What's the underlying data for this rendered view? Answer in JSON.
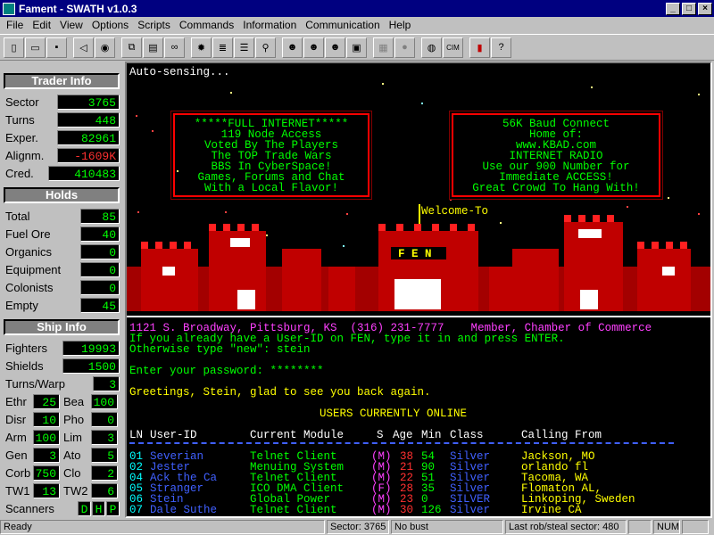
{
  "window": {
    "title": "Fament - SWATH v1.0.3"
  },
  "menu": [
    "File",
    "Edit",
    "View",
    "Options",
    "Scripts",
    "Commands",
    "Information",
    "Communication",
    "Help"
  ],
  "toolbar_icons": [
    "new-icon",
    "open-icon",
    "save-icon",
    "disconnect-icon",
    "connect-icon",
    "copy-icon",
    "paste-icon",
    "find-icon",
    "idea-icon",
    "notes-icon",
    "list-icon",
    "search-icon",
    "people-icon",
    "people2-icon",
    "people3-icon",
    "lock-icon",
    "gray1-icon",
    "gray2-icon",
    "globe-icon",
    "cim-icon",
    "book-icon",
    "help-icon"
  ],
  "trader_info": {
    "header": "Trader Info",
    "rows": [
      {
        "label": "Sector",
        "value": "3765"
      },
      {
        "label": "Turns",
        "value": "448"
      },
      {
        "label": "Exper.",
        "value": "82961"
      },
      {
        "label": "Alignm.",
        "value": "-1609K"
      },
      {
        "label": "Cred.",
        "value": "410483"
      }
    ]
  },
  "holds": {
    "header": "Holds",
    "rows": [
      {
        "label": "Total",
        "value": "85"
      },
      {
        "label": "Fuel Ore",
        "value": "40"
      },
      {
        "label": "Organics",
        "value": "0"
      },
      {
        "label": "Equipment",
        "value": "0"
      },
      {
        "label": "Colonists",
        "value": "0"
      },
      {
        "label": "Empty",
        "value": "45"
      }
    ]
  },
  "ship_info": {
    "header": "Ship Info",
    "rows": [
      {
        "label": "Fighters",
        "value": "19993"
      },
      {
        "label": "Shields",
        "value": "1500"
      },
      {
        "label": "Turns/Warp",
        "value": "3"
      }
    ],
    "pairs": [
      [
        {
          "label": "Ethr",
          "value": "25"
        },
        {
          "label": "Bea",
          "value": "100"
        }
      ],
      [
        {
          "label": "Disr",
          "value": "10"
        },
        {
          "label": "Pho",
          "value": "0"
        }
      ],
      [
        {
          "label": "Arm",
          "value": "100"
        },
        {
          "label": "Lim",
          "value": "3"
        }
      ],
      [
        {
          "label": "Gen",
          "value": "3"
        },
        {
          "label": "Ato",
          "value": "5"
        }
      ],
      [
        {
          "label": "Corb",
          "value": "750"
        },
        {
          "label": "Clo",
          "value": "2"
        }
      ],
      [
        {
          "label": "TW1",
          "value": "13"
        },
        {
          "label": "TW2",
          "value": "6"
        }
      ]
    ],
    "scanners_label": "Scanners",
    "scanners": [
      "D",
      "H",
      "P"
    ]
  },
  "terminal": {
    "auto_sensing": "Auto-sensing...",
    "box_left": "*****FULL INTERNET*****\n119 Node Access\nVoted By The Players\nThe TOP Trade Wars\nBBS In CyberSpace!\nGames, Forums and Chat\nWith a Local Flavor!",
    "box_right": "56K Baud Connect\nHome of:\nwww.KBAD.com\nINTERNET RADIO\nUse our 900 Number for\nImmediate ACCESS!\nGreat Crowd To Hang With!",
    "welcome": "Welcome-To",
    "castle_sign": "F E N",
    "address": "1121 S. Broadway, Pittsburg, KS  (316) 231-7777    Member, Chamber of Commerce",
    "userid_prompt1": "If you already have a User-ID on FEN, type it in and press ENTER.",
    "userid_prompt2": "Otherwise type \"new\": stein",
    "password_prompt": "Enter your password: ********",
    "greeting": "Greetings, Stein, glad to see you back again.",
    "users_title": "USERS CURRENTLY ONLINE",
    "columns": {
      "ln": "LN",
      "user": "User-ID",
      "module": "Current Module",
      "s": "S",
      "age": "Age",
      "min": "Min",
      "class": "Class",
      "from": "Calling From"
    },
    "users": [
      {
        "ln": "01",
        "user": "Severian",
        "module": "Telnet Client",
        "s": "(M)",
        "age": "38",
        "min": "54",
        "class": "Silver",
        "from": "Jackson, MO"
      },
      {
        "ln": "02",
        "user": "Jester",
        "module": "Menuing System",
        "s": "(M)",
        "age": "21",
        "min": "90",
        "class": "Silver",
        "from": "orlando fl"
      },
      {
        "ln": "04",
        "user": "Ack the Ca",
        "module": "Telnet Client",
        "s": "(M)",
        "age": "22",
        "min": "51",
        "class": "Silver",
        "from": "Tacoma, WA"
      },
      {
        "ln": "05",
        "user": "Stranger",
        "module": "ICO DMA Client",
        "s": "(F)",
        "age": "28",
        "min": "35",
        "class": "Silver",
        "from": "Flomaton AL,"
      },
      {
        "ln": "06",
        "user": "Stein",
        "module": "Global Power",
        "s": "(M)",
        "age": "23",
        "min": "0",
        "class": "SILVER",
        "from": "Linkoping, Sweden"
      },
      {
        "ln": "07",
        "user": "Dale Suthe",
        "module": "Telnet Client",
        "s": "(M)",
        "age": "30",
        "min": "126",
        "class": "Silver",
        "from": "Irvine CA"
      }
    ]
  },
  "status": {
    "ready": "Ready",
    "sector": "Sector: 3765",
    "bust": "No bust",
    "last_rob": "Last rob/steal sector: 480",
    "num": "NUM"
  }
}
